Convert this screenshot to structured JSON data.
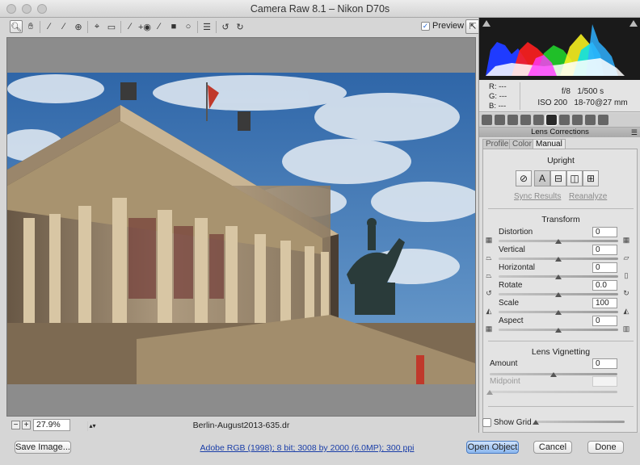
{
  "window": {
    "title": "Camera Raw 8.1  –  Nikon D70s"
  },
  "toolbar": {
    "tools": [
      "zoom-icon",
      "hand-icon",
      "white-balance-icon",
      "color-sampler-icon",
      "target-adjust-icon",
      "crop-icon",
      "straighten-icon",
      "spot-removal-icon",
      "red-eye-icon",
      "adjustment-brush-icon",
      "graduated-filter-icon",
      "radial-filter-icon",
      "preferences-icon",
      "rotate-ccw-icon",
      "rotate-cw-icon"
    ],
    "preview_label": "Preview",
    "preview_checked": true
  },
  "status": {
    "zoom": "27.9%",
    "filename": "Berlin-August2013-635.dr"
  },
  "camera_info": {
    "r_label": "R:",
    "r_value": "---",
    "g_label": "G:",
    "g_value": "---",
    "b_label": "B:",
    "b_value": "---",
    "aperture": "f/8",
    "shutter": "1/500 s",
    "iso": "ISO 200",
    "lens": "18-70@27 mm"
  },
  "panel": {
    "title": "Lens Corrections",
    "tabs": [
      "Profile",
      "Color",
      "Manual"
    ],
    "active_tab": "Manual",
    "upright": {
      "title": "Upright",
      "buttons": [
        "off-icon",
        "A",
        "level-icon",
        "vertical-icon",
        "full-icon"
      ],
      "sync_label": "Sync Results",
      "reanalyze_label": "Reanalyze"
    },
    "transform": {
      "title": "Transform",
      "sliders": [
        {
          "label": "Distortion",
          "value": "0",
          "fraction": 0.5
        },
        {
          "label": "Vertical",
          "value": "0",
          "fraction": 0.5
        },
        {
          "label": "Horizontal",
          "value": "0",
          "fraction": 0.5
        },
        {
          "label": "Rotate",
          "value": "0.0",
          "fraction": 0.5
        },
        {
          "label": "Scale",
          "value": "100",
          "fraction": 0.5
        },
        {
          "label": "Aspect",
          "value": "0",
          "fraction": 0.5
        }
      ]
    },
    "vignetting": {
      "title": "Lens Vignetting",
      "amount_label": "Amount",
      "amount_value": "0",
      "amount_fraction": 0.5,
      "midpoint_label": "Midpoint",
      "midpoint_value": "",
      "midpoint_fraction": 0.0
    },
    "show_grid_label": "Show Grid"
  },
  "bottom": {
    "save_label": "Save Image...",
    "workflow_label": "Adobe RGB (1998); 8 bit; 3008 by 2000 (6.0MP); 300 ppi",
    "open_label": "Open Object",
    "cancel_label": "Cancel",
    "done_label": "Done"
  }
}
